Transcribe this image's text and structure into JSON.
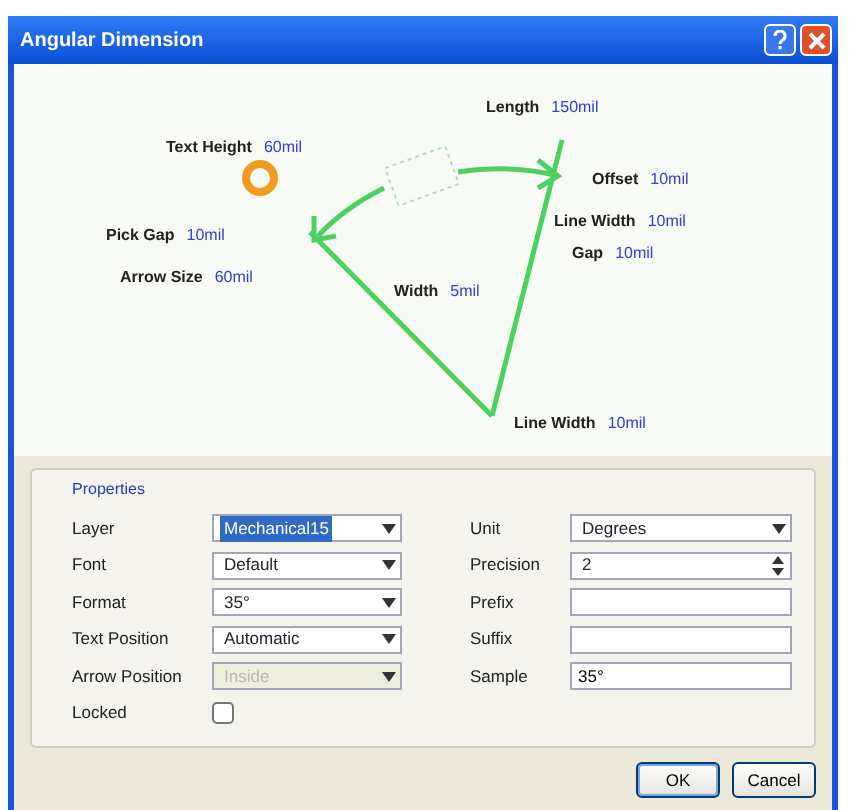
{
  "window": {
    "title": "Angular Dimension"
  },
  "diagram": {
    "labels": [
      {
        "name": "Text Height",
        "value": "60mil"
      },
      {
        "name": "Length",
        "value": "150mil"
      },
      {
        "name": "Offset",
        "value": "10mil"
      },
      {
        "name": "Line Width",
        "value": "10mil"
      },
      {
        "name": "Gap",
        "value": "10mil"
      },
      {
        "name": "Pick Gap",
        "value": "10mil"
      },
      {
        "name": "Arrow Size",
        "value": "60mil"
      },
      {
        "name": "Width",
        "value": "5mil"
      },
      {
        "name": "Line Width",
        "value": "10mil"
      }
    ]
  },
  "properties": {
    "title": "Properties",
    "left": [
      {
        "label": "Layer",
        "kind": "select",
        "value": "Mechanical15",
        "focused": true,
        "disabled": false
      },
      {
        "label": "Font",
        "kind": "select",
        "value": "Default",
        "focused": false,
        "disabled": false
      },
      {
        "label": "Format",
        "kind": "select",
        "value": "35°",
        "focused": false,
        "disabled": false
      },
      {
        "label": "Text Position",
        "kind": "select",
        "value": "Automatic",
        "focused": false,
        "disabled": false
      },
      {
        "label": "Arrow Position",
        "kind": "select",
        "value": "Inside",
        "focused": false,
        "disabled": true
      },
      {
        "label": "Locked",
        "kind": "checkbox",
        "checked": false
      }
    ],
    "right": [
      {
        "label": "Unit",
        "kind": "select",
        "value": "Degrees"
      },
      {
        "label": "Precision",
        "kind": "spin",
        "value": "2"
      },
      {
        "label": "Prefix",
        "kind": "text"
      },
      {
        "label": "Suffix",
        "kind": "text"
      },
      {
        "label": "Sample",
        "kind": "text",
        "value": "35°"
      }
    ]
  },
  "buttons": [
    "OK",
    "Cancel"
  ]
}
